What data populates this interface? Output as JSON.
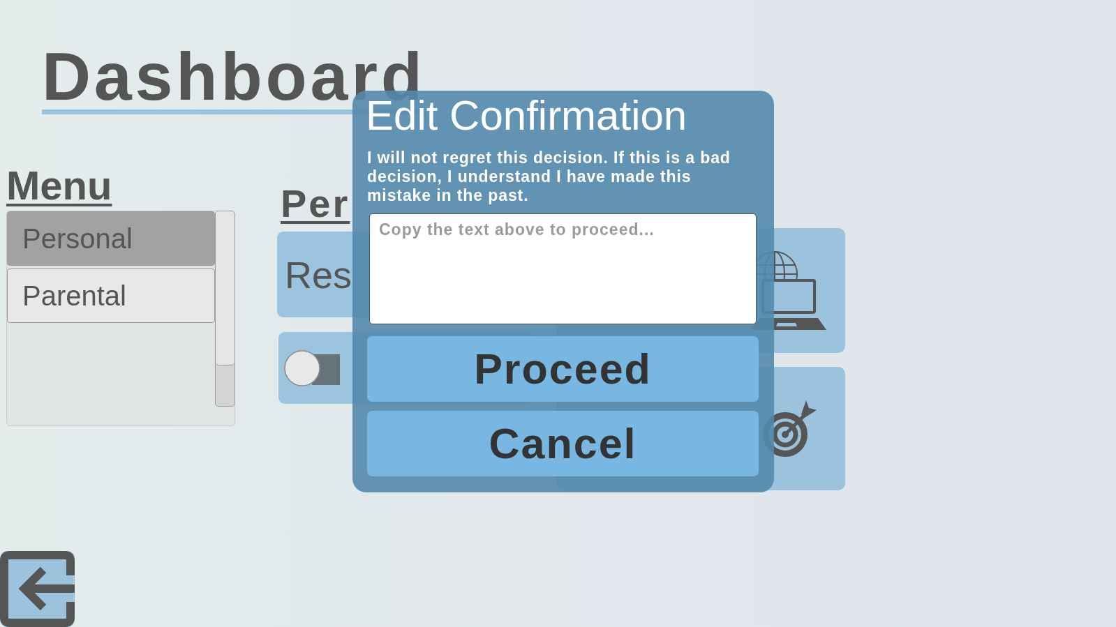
{
  "page": {
    "title": "Dashboard"
  },
  "menu": {
    "heading": "Menu",
    "items": [
      {
        "label": "Personal",
        "selected": true
      },
      {
        "label": "Parental",
        "selected": false
      }
    ]
  },
  "section": {
    "heading": "Per",
    "cards": [
      {
        "kind": "button",
        "label": "Res"
      },
      {
        "kind": "toggle",
        "on": false
      }
    ]
  },
  "dialog": {
    "title": "Edit Confirmation",
    "message": "I will not regret this decision. If this is a bad decision, I understand I have made this mistake in the past.",
    "input": {
      "placeholder": "Copy the text above to proceed..."
    },
    "buttons": [
      "Proceed",
      "Cancel"
    ]
  }
}
